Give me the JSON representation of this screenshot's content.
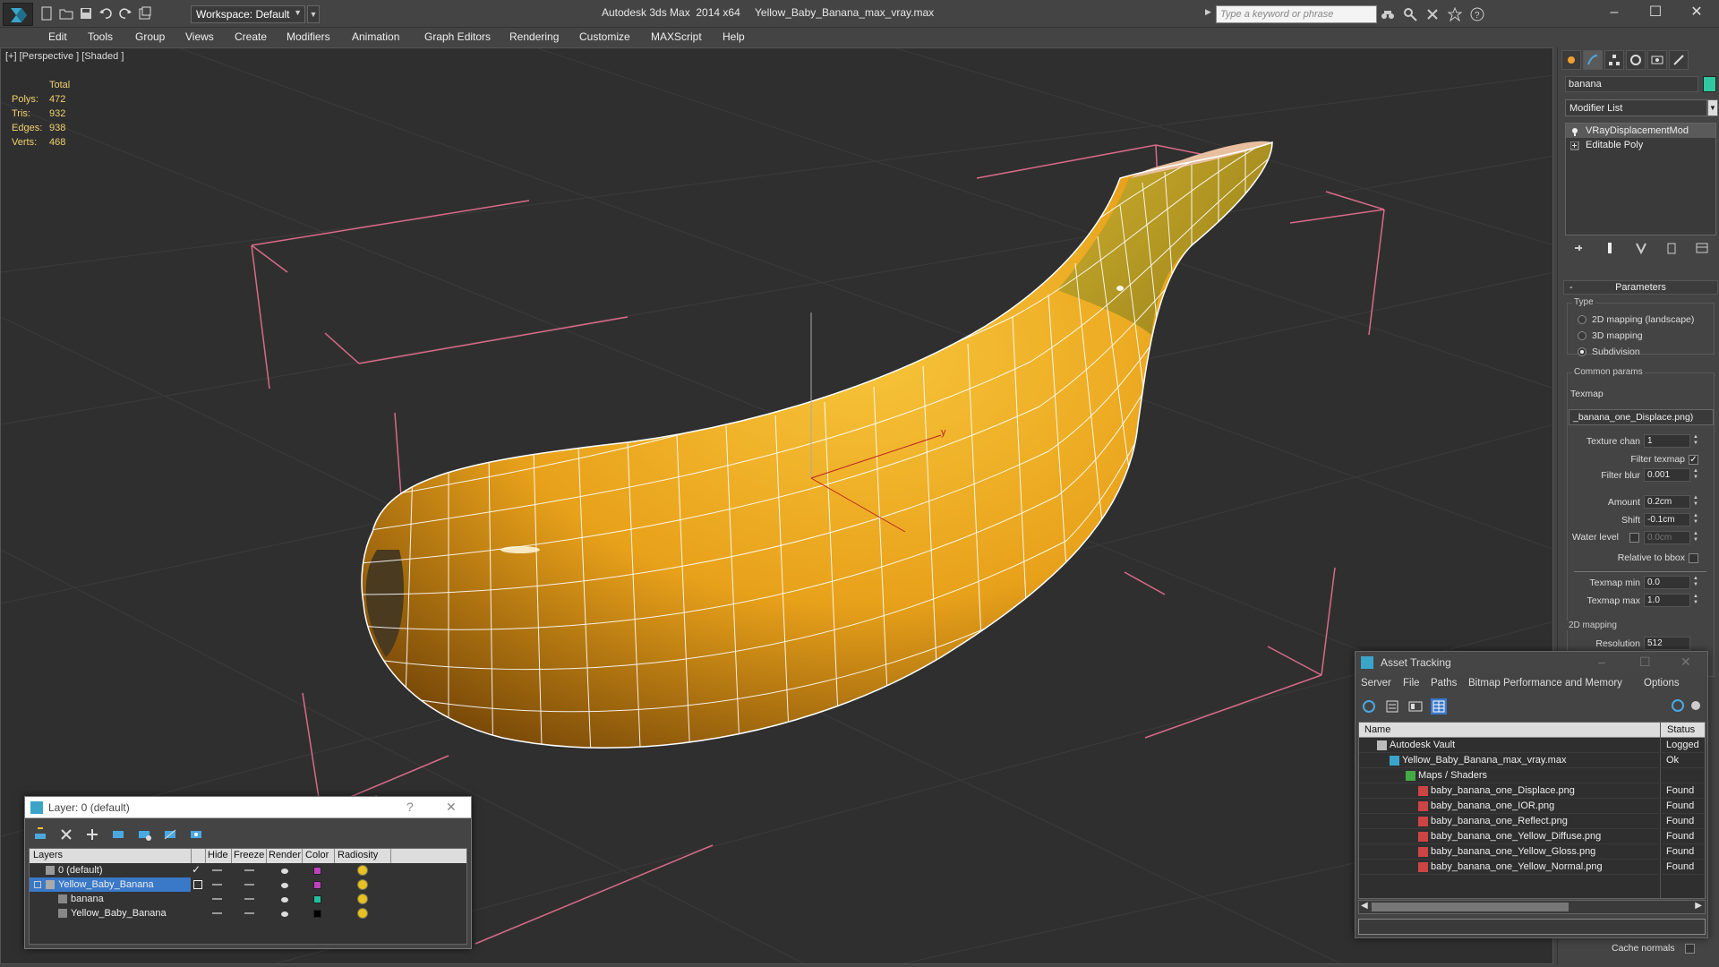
{
  "app": {
    "title": "Autodesk 3ds Max  2014 x64",
    "file": "Yellow_Baby_Banana_max_vray.max",
    "workspace": "Workspace: Default",
    "search_placeholder": "Type a keyword or phrase"
  },
  "menu": [
    "Edit",
    "Tools",
    "Group",
    "Views",
    "Create",
    "Modifiers",
    "Animation",
    "Graph Editors",
    "Rendering",
    "Customize",
    "MAXScript",
    "Help"
  ],
  "viewport": {
    "label": "[+] [Perspective ] [Shaded ]",
    "stats": {
      "header": "Total",
      "rows": [
        {
          "label": "Polys:",
          "value": "472"
        },
        {
          "label": "Tris:",
          "value": "932"
        },
        {
          "label": "Edges:",
          "value": "938"
        },
        {
          "label": "Verts:",
          "value": "468"
        }
      ]
    },
    "gizmo_axis_label": "y"
  },
  "command_panel": {
    "object_name": "banana",
    "object_color": "#2fc8a0",
    "modifier_list": "Modifier List",
    "stack": [
      "VRayDisplacementMod",
      "Editable Poly"
    ],
    "rollout_title": "Parameters",
    "type_group": "Type",
    "type_options": [
      "2D mapping (landscape)",
      "3D mapping",
      "Subdivision"
    ],
    "type_selected": "Subdivision",
    "common_group": "Common params",
    "texmap_label": "Texmap",
    "texmap_value": "_banana_one_Displace.png)",
    "params": [
      {
        "label": "Texture chan",
        "value": "1"
      },
      {
        "label": "Filter texmap",
        "checked": true
      },
      {
        "label": "Filter blur",
        "value": "0.001"
      },
      {
        "label": "Amount",
        "value": "0.2cm"
      },
      {
        "label": "Shift",
        "value": "-0.1cm"
      },
      {
        "label": "Water level",
        "value": "0.0cm"
      },
      {
        "label": "Relative to bbox"
      },
      {
        "label": "Texmap min",
        "value": "0.0"
      },
      {
        "label": "Texmap max",
        "value": "1.0"
      }
    ],
    "mapping_group": "2D mapping",
    "resolution_label": "Resolution",
    "resolution_value": "512",
    "cache_normals": "Cache normals"
  },
  "asset_tracking": {
    "title": "Asset Tracking",
    "menu": [
      "Server",
      "File",
      "Paths",
      "Bitmap Performance and Memory",
      "Options"
    ],
    "columns": [
      "Name",
      "Status"
    ],
    "rows": [
      {
        "name": "Autodesk Vault",
        "status": "Logged"
      },
      {
        "name": "Yellow_Baby_Banana_max_vray.max",
        "status": "Ok"
      },
      {
        "name": "Maps / Shaders",
        "status": ""
      },
      {
        "name": "baby_banana_one_Displace.png",
        "status": "Found"
      },
      {
        "name": "baby_banana_one_IOR.png",
        "status": "Found"
      },
      {
        "name": "baby_banana_one_Reflect.png",
        "status": "Found"
      },
      {
        "name": "baby_banana_one_Yellow_Diffuse.png",
        "status": "Found"
      },
      {
        "name": "baby_banana_one_Yellow_Gloss.png",
        "status": "Found"
      },
      {
        "name": "baby_banana_one_Yellow_Normal.png",
        "status": "Found"
      }
    ]
  },
  "layer_window": {
    "title": "Layer: 0 (default)",
    "help": "?",
    "columns": [
      "Layers",
      "Hide",
      "Freeze",
      "Render",
      "Color",
      "Radiosity"
    ],
    "rows": [
      {
        "name": "0 (default)",
        "color": "#c040c0"
      },
      {
        "name": "Yellow_Baby_Banana",
        "color": "#c040c0"
      },
      {
        "name": "banana",
        "color": "#20c0a0"
      },
      {
        "name": "Yellow_Baby_Banana",
        "color": "#000000"
      }
    ]
  }
}
